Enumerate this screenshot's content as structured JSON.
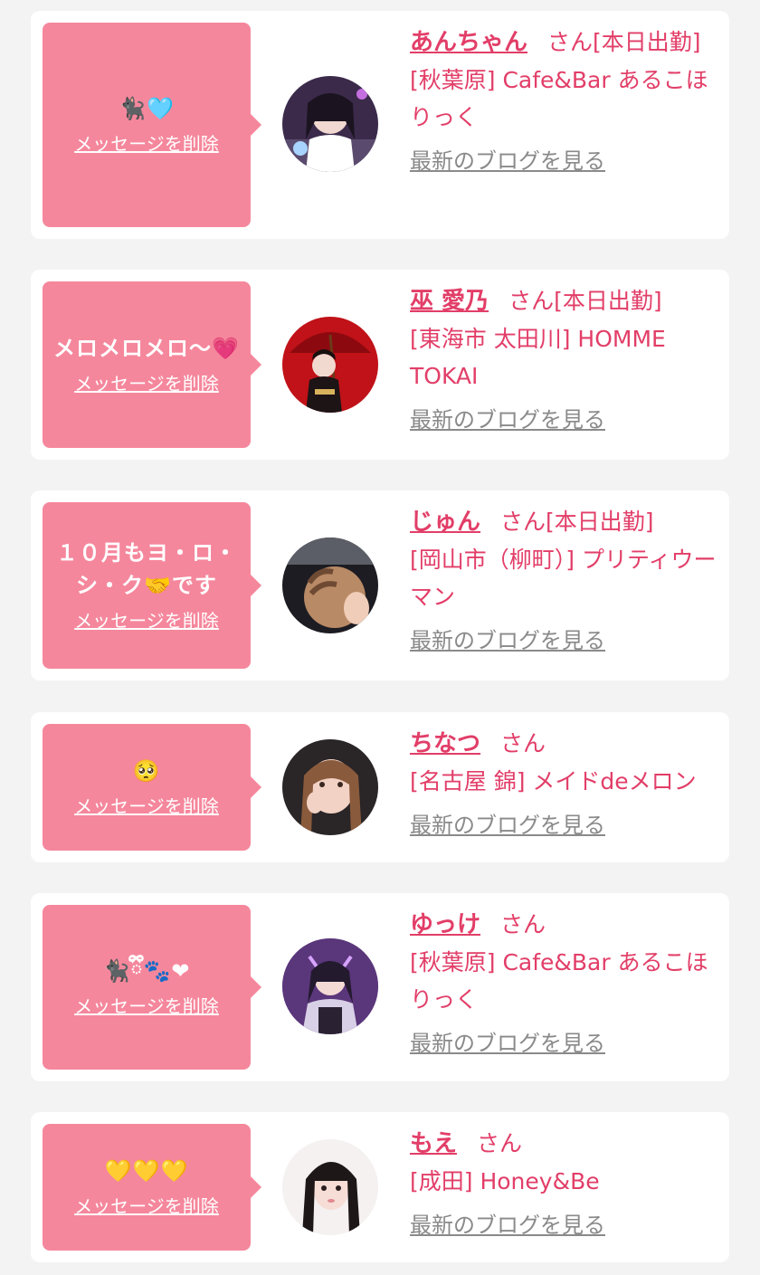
{
  "colors": {
    "bubble": "#f5879c",
    "accent": "#e23e68",
    "link_gray": "#8a8a8a",
    "page_bg": "#f3f3f3"
  },
  "delete_label": "メッセージを削除",
  "blog_label": "最新のブログを見る",
  "san": "さん",
  "cards": [
    {
      "message": "🐈‍⬛🩵",
      "name": "あんちゃん",
      "detail": "[本日出勤]",
      "shop": "[秋葉原] Cafe&Bar あるこほりっく",
      "avatar_icon": "avatar-photo"
    },
    {
      "message": "メロメロメロ〜💗",
      "name": "巫 愛乃",
      "detail": "[本日出勤]",
      "shop": "[東海市 太田川] HOMME TOKAI",
      "avatar_icon": "avatar-photo"
    },
    {
      "message": "１０月もヨ・ロ・シ・ク🤝です",
      "name": "じゅん",
      "detail": "[本日出勤]",
      "shop": "[岡山市（柳町）] プリティウーマン",
      "avatar_icon": "avatar-photo"
    },
    {
      "message": "🥺",
      "name": "ちなつ",
      "detail": "",
      "shop": "[名古屋 錦] メイドdeメロン",
      "avatar_icon": "avatar-photo"
    },
    {
      "message": "🐈‍⬛ྀི🐾❤",
      "name": "ゆっけ",
      "detail": "",
      "shop": "[秋葉原] Cafe&Bar あるこほりっく",
      "avatar_icon": "avatar-photo"
    },
    {
      "message": "💛💛💛",
      "name": "もえ",
      "detail": "",
      "shop": "[成田] Honey&Be",
      "avatar_icon": "avatar-photo"
    }
  ]
}
